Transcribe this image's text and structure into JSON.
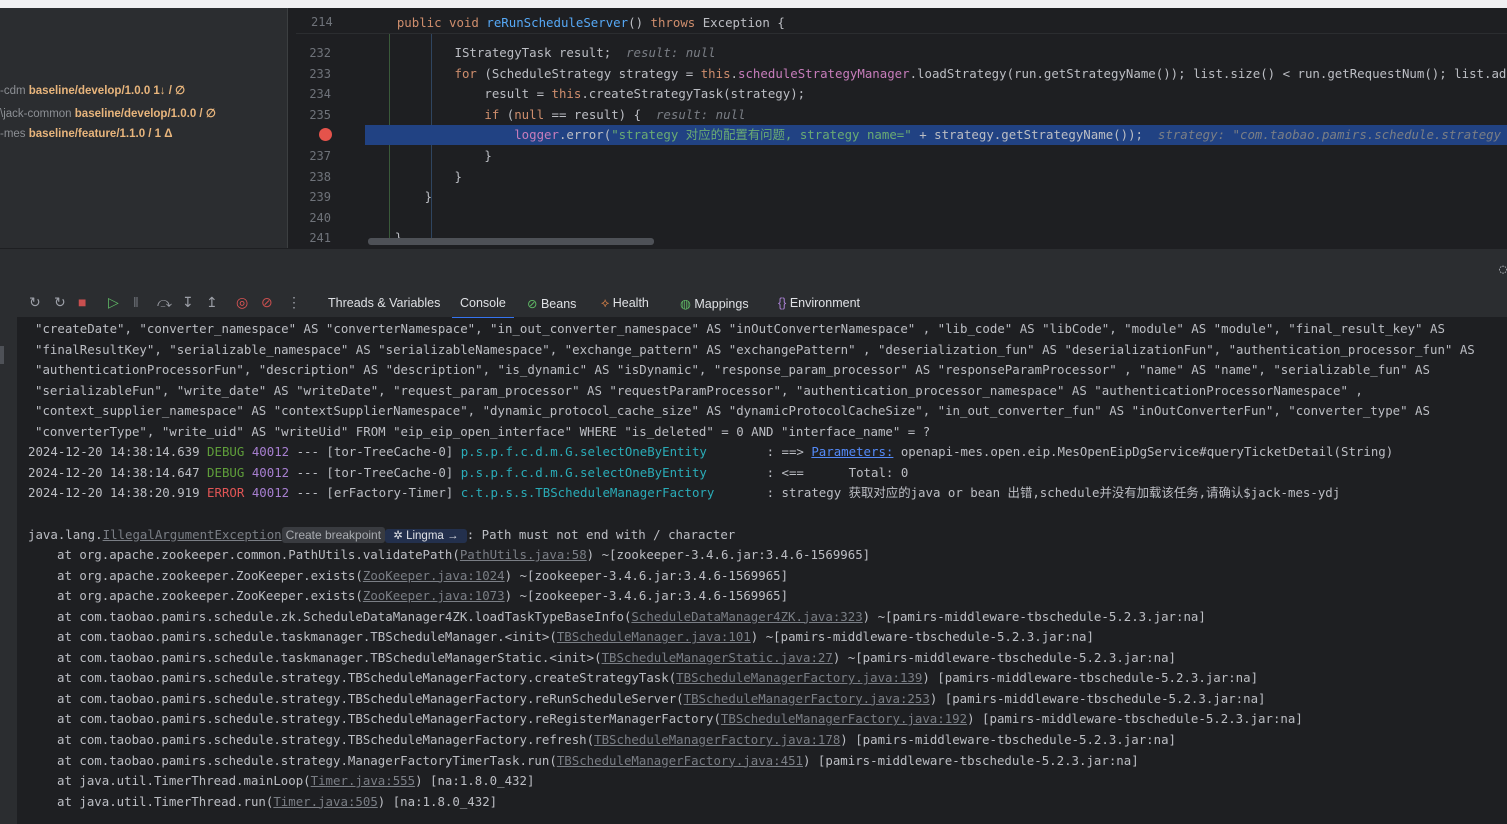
{
  "projects": [
    {
      "name": "-cdm",
      "branch": "baseline/develop/1.0.0 1↓ / ∅"
    },
    {
      "name": "\\jack-common",
      "branch": "baseline/develop/1.0.0 / ∅"
    },
    {
      "name": "-mes",
      "branch": "baseline/feature/1.1.0 / 1 Δ"
    }
  ],
  "editor": {
    "sticky": {
      "num": "214",
      "segs": [
        {
          "t": "    public void ",
          "c": "kw"
        },
        {
          "t": "reRunScheduleServer",
          "c": "fn"
        },
        {
          "t": "() ",
          "c": "df"
        },
        {
          "t": "throws ",
          "c": "kw"
        },
        {
          "t": "Exception {",
          "c": "df"
        }
      ]
    },
    "lines": [
      {
        "num": "232",
        "segs": [
          {
            "t": "            IStrategyTask result;  ",
            "c": "df"
          },
          {
            "t": "result: null",
            "c": "hint"
          }
        ]
      },
      {
        "num": "233",
        "segs": [
          {
            "t": "            for ",
            "c": "kw"
          },
          {
            "t": "(ScheduleStrategy strategy = ",
            "c": "df"
          },
          {
            "t": "this",
            "c": "kw"
          },
          {
            "t": ".",
            "c": "df"
          },
          {
            "t": "scheduleStrategyManager",
            "c": "fld"
          },
          {
            "t": ".loadStrategy(run.getStrategyName()); list.size() < run.getRequestNum(); list.ad",
            "c": "df"
          }
        ]
      },
      {
        "num": "234",
        "segs": [
          {
            "t": "                result = ",
            "c": "df"
          },
          {
            "t": "this",
            "c": "kw"
          },
          {
            "t": ".createStrategyTask(strategy);",
            "c": "df"
          }
        ]
      },
      {
        "num": "235",
        "segs": [
          {
            "t": "                if ",
            "c": "kw"
          },
          {
            "t": "(",
            "c": "df"
          },
          {
            "t": "null",
            "c": "kw"
          },
          {
            "t": " == result) {  ",
            "c": "df"
          },
          {
            "t": "result: null",
            "c": "hint"
          }
        ]
      },
      {
        "num": "",
        "hl": true,
        "segs": [
          {
            "t": "                    logger",
            "c": "fld"
          },
          {
            "t": ".error(",
            "c": "df"
          },
          {
            "t": "\"strategy 对应的配置有问题, strategy name=\"",
            "c": "str"
          },
          {
            "t": " + strategy.getStrategyName());  ",
            "c": "df"
          },
          {
            "t": "strategy: \"com.taobao.pamirs.schedule.strategy",
            "c": "hint"
          }
        ]
      },
      {
        "num": "237",
        "segs": [
          {
            "t": "                }",
            "c": "df"
          }
        ]
      },
      {
        "num": "238",
        "segs": [
          {
            "t": "            }",
            "c": "df"
          }
        ]
      },
      {
        "num": "239",
        "segs": [
          {
            "t": "        }",
            "c": "df"
          }
        ]
      },
      {
        "num": "240",
        "segs": [
          {
            "t": "",
            "c": "df"
          }
        ]
      },
      {
        "num": "241",
        "segs": [
          {
            "t": "    }",
            "c": "df"
          }
        ]
      }
    ]
  },
  "toolbar": {
    "icons": [
      "rerun-icon",
      "restart-icon",
      "stop-icon",
      "resume-icon",
      "pause-icon",
      "step-over-icon",
      "step-into-icon",
      "step-out-icon",
      "view-breakpoints-icon",
      "mute-breakpoints-icon",
      "more-icon"
    ],
    "tabs": [
      {
        "label": "Threads & Variables",
        "icon": ""
      },
      {
        "label": "Console",
        "icon": "",
        "active": true
      },
      {
        "label": "Beans",
        "icon": "⊘",
        "color": "#5fb865"
      },
      {
        "label": "Health",
        "icon": "⟡",
        "color": "#e0864a"
      },
      {
        "label": "Mappings",
        "icon": "◍",
        "color": "#5fb865"
      },
      {
        "label": "Environment",
        "icon": "{}",
        "color": "#a77fd0"
      }
    ]
  },
  "console": {
    "lines": [
      {
        "x": 18,
        "segs": [
          {
            "t": "\"createDate\", \"converter_namespace\" AS \"converterNamespace\", \"in_out_converter_namespace\" AS \"inOutConverterNamespace\" , \"lib_code\" AS \"libCode\", \"module\" AS \"module\", \"final_result_key\" AS",
            "c": "df"
          }
        ]
      },
      {
        "x": 18,
        "segs": [
          {
            "t": "\"finalResultKey\", \"serializable_namespace\" AS \"serializableNamespace\", \"exchange_pattern\" AS \"exchangePattern\" , \"deserialization_fun\" AS \"deserializationFun\", \"authentication_processor_fun\" AS",
            "c": "df"
          }
        ]
      },
      {
        "x": 18,
        "segs": [
          {
            "t": "\"authenticationProcessorFun\", \"description\" AS \"description\", \"is_dynamic\" AS \"isDynamic\", \"response_param_processor\" AS \"responseParamProcessor\" , \"name\" AS \"name\", \"serializable_fun\" AS",
            "c": "df"
          }
        ]
      },
      {
        "x": 18,
        "segs": [
          {
            "t": "\"serializableFun\", \"write_date\" AS \"writeDate\", \"request_param_processor\" AS \"requestParamProcessor\", \"authentication_processor_namespace\" AS \"authenticationProcessorNamespace\" ,",
            "c": "df"
          }
        ]
      },
      {
        "x": 18,
        "segs": [
          {
            "t": "\"context_supplier_namespace\" AS \"contextSupplierNamespace\", \"dynamic_protocol_cache_size\" AS \"dynamicProtocolCacheSize\", \"in_out_converter_fun\" AS \"inOutConverterFun\", \"converter_type\" AS",
            "c": "df"
          }
        ]
      },
      {
        "x": 18,
        "segs": [
          {
            "t": "\"converterType\", \"write_uid\" AS \"writeUid\" FROM \"eip_eip_open_interface\" WHERE \"is_deleted\" = 0 AND \"interface_name\" = ?",
            "c": "df"
          }
        ]
      },
      {
        "x": 11,
        "segs": [
          {
            "t": "2024-12-20 14:38:14.639 ",
            "c": "time"
          },
          {
            "t": "DEBUG ",
            "c": "dbg"
          },
          {
            "t": "40012",
            "c": "pid"
          },
          {
            "t": " --- [tor-TreeCache-0] ",
            "c": "df"
          },
          {
            "t": "p.s.p.f.c.d.m.G.selectOneByEntity       ",
            "c": "lg"
          },
          {
            "t": " : ==> ",
            "c": "df"
          },
          {
            "t": "Parameters:",
            "c": "plink"
          },
          {
            "t": " openapi-mes.open.eip.MesOpenEipDgService#queryTicketDetail(String)",
            "c": "df"
          }
        ]
      },
      {
        "x": 11,
        "segs": [
          {
            "t": "2024-12-20 14:38:14.647 ",
            "c": "time"
          },
          {
            "t": "DEBUG ",
            "c": "dbg"
          },
          {
            "t": "40012",
            "c": "pid"
          },
          {
            "t": " --- [tor-TreeCache-0] ",
            "c": "df"
          },
          {
            "t": "p.s.p.f.c.d.m.G.selectOneByEntity       ",
            "c": "lg"
          },
          {
            "t": " : <==      Total: 0",
            "c": "df"
          }
        ]
      },
      {
        "x": 11,
        "segs": [
          {
            "t": "2024-12-20 14:38:20.919 ",
            "c": "time"
          },
          {
            "t": "ERROR ",
            "c": "err"
          },
          {
            "t": "40012",
            "c": "pid"
          },
          {
            "t": " --- [erFactory-Timer] ",
            "c": "df"
          },
          {
            "t": "c.t.p.s.s.TBScheduleManagerFactory      ",
            "c": "lg"
          },
          {
            "t": " : strategy 获取对应的java or bean 出错,schedule并没有加载该任务,请确认$jack-mes-ydj",
            "c": "df"
          }
        ]
      },
      {
        "x": 11,
        "segs": [
          {
            "t": "",
            "c": "df"
          }
        ]
      },
      {
        "x": 11,
        "segs": [
          {
            "t": "java.lang.",
            "c": "exc"
          },
          {
            "t": "IllegalArgumentException",
            "c": "lnk"
          },
          {
            "t": "Create breakpoint",
            "c": "cbp"
          },
          {
            "t": " ✲ Lingma → ",
            "c": "lingma"
          },
          {
            "t": ": Path must not end with / character",
            "c": "df"
          }
        ]
      },
      {
        "x": 40,
        "segs": [
          {
            "t": "at org.apache.zookeeper.common.PathUtils.validatePath(",
            "c": "df"
          },
          {
            "t": "PathUtils.java:58",
            "c": "lnk"
          },
          {
            "t": ") ~[zookeeper-3.4.6.jar:3.4.6-1569965]",
            "c": "df"
          }
        ]
      },
      {
        "x": 40,
        "segs": [
          {
            "t": "at org.apache.zookeeper.ZooKeeper.exists(",
            "c": "df"
          },
          {
            "t": "ZooKeeper.java:1024",
            "c": "lnk"
          },
          {
            "t": ") ~[zookeeper-3.4.6.jar:3.4.6-1569965]",
            "c": "df"
          }
        ]
      },
      {
        "x": 40,
        "segs": [
          {
            "t": "at org.apache.zookeeper.ZooKeeper.exists(",
            "c": "df"
          },
          {
            "t": "ZooKeeper.java:1073",
            "c": "lnk"
          },
          {
            "t": ") ~[zookeeper-3.4.6.jar:3.4.6-1569965]",
            "c": "df"
          }
        ]
      },
      {
        "x": 40,
        "segs": [
          {
            "t": "at com.taobao.pamirs.schedule.zk.ScheduleDataManager4ZK.loadTaskTypeBaseInfo(",
            "c": "df"
          },
          {
            "t": "ScheduleDataManager4ZK.java:323",
            "c": "lnk"
          },
          {
            "t": ") ~[pamirs-middleware-tbschedule-5.2.3.jar:na]",
            "c": "df"
          }
        ]
      },
      {
        "x": 40,
        "segs": [
          {
            "t": "at com.taobao.pamirs.schedule.taskmanager.TBScheduleManager.<init>(",
            "c": "df"
          },
          {
            "t": "TBScheduleManager.java:101",
            "c": "lnk"
          },
          {
            "t": ") ~[pamirs-middleware-tbschedule-5.2.3.jar:na]",
            "c": "df"
          }
        ]
      },
      {
        "x": 40,
        "segs": [
          {
            "t": "at com.taobao.pamirs.schedule.taskmanager.TBScheduleManagerStatic.<init>(",
            "c": "df"
          },
          {
            "t": "TBScheduleManagerStatic.java:27",
            "c": "lnk"
          },
          {
            "t": ") ~[pamirs-middleware-tbschedule-5.2.3.jar:na]",
            "c": "df"
          }
        ]
      },
      {
        "x": 40,
        "segs": [
          {
            "t": "at com.taobao.pamirs.schedule.strategy.TBScheduleManagerFactory.createStrategyTask(",
            "c": "df"
          },
          {
            "t": "TBScheduleManagerFactory.java:139",
            "c": "lnk"
          },
          {
            "t": ") [pamirs-middleware-tbschedule-5.2.3.jar:na]",
            "c": "df"
          }
        ]
      },
      {
        "x": 40,
        "segs": [
          {
            "t": "at com.taobao.pamirs.schedule.strategy.TBScheduleManagerFactory.reRunScheduleServer(",
            "c": "df"
          },
          {
            "t": "TBScheduleManagerFactory.java:253",
            "c": "lnk"
          },
          {
            "t": ") [pamirs-middleware-tbschedule-5.2.3.jar:na]",
            "c": "df"
          }
        ]
      },
      {
        "x": 40,
        "segs": [
          {
            "t": "at com.taobao.pamirs.schedule.strategy.TBScheduleManagerFactory.reRegisterManagerFactory(",
            "c": "df"
          },
          {
            "t": "TBScheduleManagerFactory.java:192",
            "c": "lnk"
          },
          {
            "t": ") [pamirs-middleware-tbschedule-5.2.3.jar:na]",
            "c": "df"
          }
        ]
      },
      {
        "x": 40,
        "segs": [
          {
            "t": "at com.taobao.pamirs.schedule.strategy.TBScheduleManagerFactory.refresh(",
            "c": "df"
          },
          {
            "t": "TBScheduleManagerFactory.java:178",
            "c": "lnk"
          },
          {
            "t": ") [pamirs-middleware-tbschedule-5.2.3.jar:na]",
            "c": "df"
          }
        ]
      },
      {
        "x": 40,
        "segs": [
          {
            "t": "at com.taobao.pamirs.schedule.strategy.ManagerFactoryTimerTask.run(",
            "c": "df"
          },
          {
            "t": "TBScheduleManagerFactory.java:451",
            "c": "lnk"
          },
          {
            "t": ") [pamirs-middleware-tbschedule-5.2.3.jar:na]",
            "c": "df"
          }
        ]
      },
      {
        "x": 40,
        "segs": [
          {
            "t": "at java.util.TimerThread.mainLoop(",
            "c": "df"
          },
          {
            "t": "Timer.java:555",
            "c": "lnk"
          },
          {
            "t": ") [na:1.8.0_432]",
            "c": "df"
          }
        ]
      },
      {
        "x": 40,
        "segs": [
          {
            "t": "at java.util.TimerThread.run(",
            "c": "df"
          },
          {
            "t": "Timer.java:505",
            "c": "lnk"
          },
          {
            "t": ") [na:1.8.0_432]",
            "c": "df"
          }
        ]
      }
    ]
  }
}
